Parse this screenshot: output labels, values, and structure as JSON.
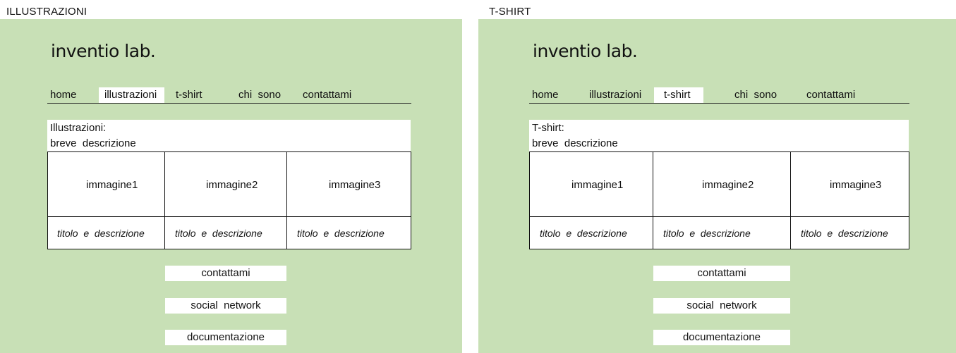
{
  "frames": [
    {
      "title": "ILLUSTRAZIONI",
      "logo": "inventio lab.",
      "nav": [
        "home",
        "illustrazioni",
        "t-shirt",
        "chi  sono",
        "contattami"
      ],
      "active_nav": "illustrazioni",
      "description": {
        "heading": "Illustrazioni:",
        "text": "breve  descrizione"
      },
      "images": [
        "immagine1",
        "immagine2",
        "immagine3"
      ],
      "captions": [
        "titolo  e  descrizione",
        "titolo  e  descrizione",
        "titolo  e  descrizione"
      ],
      "footer_buttons": [
        "contattami",
        "social  network",
        "documentazione"
      ]
    },
    {
      "title": "T-SHIRT",
      "logo": "inventio lab.",
      "nav": [
        "home",
        "illustrazioni",
        "t-shirt",
        "chi  sono",
        "contattami"
      ],
      "active_nav": "t-shirt",
      "description": {
        "heading": "T-shirt:",
        "text": "breve  descrizione"
      },
      "images": [
        "immagine1",
        "immagine2",
        "immagine3"
      ],
      "captions": [
        "titolo  e  descrizione",
        "titolo  e  descrizione",
        "titolo  e  descrizione"
      ],
      "footer_buttons": [
        "contattami",
        "social  network",
        "documentazione"
      ]
    }
  ],
  "colors": {
    "background": "#c8e0b6",
    "panel": "#ffffff",
    "line": "#111111"
  }
}
